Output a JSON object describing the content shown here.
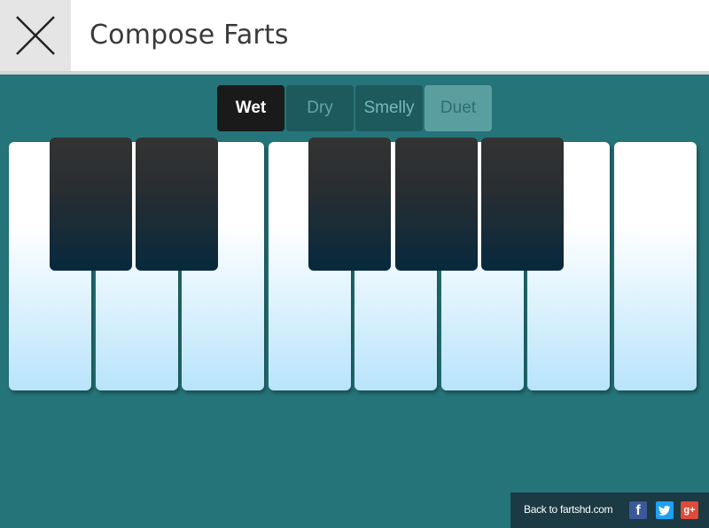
{
  "header": {
    "title": "Compose Farts",
    "close_icon": "close-icon"
  },
  "tabs": [
    {
      "label": "Wet",
      "active": true
    },
    {
      "label": "Dry",
      "active": false
    },
    {
      "label": "Smelly",
      "active": false
    },
    {
      "label": "Duet",
      "active": false
    }
  ],
  "keyboard": {
    "white_keys": 8,
    "black_keys": 5
  },
  "footer": {
    "back_link": "Back to fartshd.com",
    "social": [
      "facebook-icon",
      "twitter-icon",
      "google-plus-icon"
    ],
    "facebook_glyph": "f",
    "google_glyph": "g+"
  },
  "colors": {
    "background": "#257479",
    "active_tab": "#1a1a1a",
    "footer": "#1b3a43"
  }
}
